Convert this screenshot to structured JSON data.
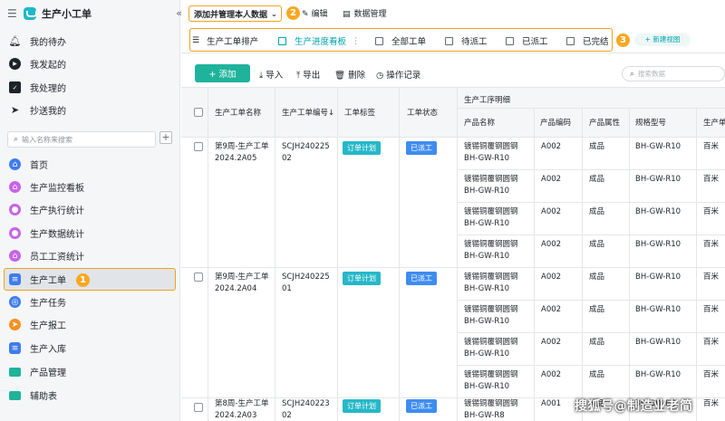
{
  "app": {
    "title": "生产小工单",
    "menu_icon": "hamburger-icon",
    "collapse_glyph": "«"
  },
  "sidebar": {
    "top_items": [
      {
        "label": "我的待办",
        "icon": "bell-icon"
      },
      {
        "label": "我发起的",
        "icon": "play-circle-icon"
      },
      {
        "label": "我处理的",
        "icon": "inbox-icon"
      },
      {
        "label": "抄送我的",
        "icon": "send-icon"
      }
    ],
    "search_placeholder": "输入名称来搜索",
    "plus": "+",
    "items": [
      {
        "label": "首页",
        "icon": "home-icon",
        "color": "#3f7cf1"
      },
      {
        "label": "生产监控看板",
        "icon": "house-icon",
        "color": "#c764e8"
      },
      {
        "label": "生产执行统计",
        "icon": "palette-icon",
        "color": "#c764e8"
      },
      {
        "label": "生产数据统计",
        "icon": "palette-icon",
        "color": "#c764e8"
      },
      {
        "label": "员工工资统计",
        "icon": "house-icon",
        "color": "#c764e8"
      },
      {
        "label": "生产工单",
        "icon": "document-icon",
        "color": "#3f7cf1"
      },
      {
        "label": "生产任务",
        "icon": "target-icon",
        "color": "#3f7cf1"
      },
      {
        "label": "生产报工",
        "icon": "arrow-icon",
        "color": "#f7901e"
      },
      {
        "label": "生产入库",
        "icon": "document-icon",
        "color": "#3f7cf1"
      },
      {
        "label": "产品管理",
        "icon": "folder-icon",
        "color": "#1fb39c"
      },
      {
        "label": "辅助表",
        "icon": "folder-icon",
        "color": "#1fb39c"
      }
    ]
  },
  "badges": {
    "one": "1",
    "two": "2",
    "three": "3"
  },
  "topbar": {
    "view_select": "添加并管理本人数据",
    "edit": "编辑",
    "data_mgmt": "数据管理"
  },
  "tabs": [
    {
      "label": "生产工单排产"
    },
    {
      "label": "生产进度看板",
      "more": "⋮"
    },
    {
      "label": "全部工单"
    },
    {
      "label": "待派工"
    },
    {
      "label": "已派工"
    },
    {
      "label": "已完结"
    }
  ],
  "new_view": "+ 新建视图",
  "toolbar": {
    "add": "+ 添加",
    "import": "导入",
    "export": "导出",
    "delete": "删除",
    "log": "操作记录",
    "search_placeholder": "搜索数据"
  },
  "columns": {
    "name": "生产工单名称",
    "code": "生产工单编号↓",
    "tag": "工单标签",
    "status": "工单状态",
    "group": "生产工序明细",
    "product": "产品名称",
    "pcode": "产品编码",
    "attr": "产品属性",
    "spec": "规格型号",
    "unit": "生产单"
  },
  "orders": [
    {
      "name": "第9周-生产工单2024.2A05",
      "code": "SCJH24022502",
      "tag": "订单计划",
      "status": "已派工",
      "rows": [
        {
          "product": "镀锡铜覆钢圆钢BH-GW-R10",
          "pcode": "A002",
          "attr": "成品",
          "spec": "BH-GW-R10",
          "unit": "百米"
        },
        {
          "product": "镀锡铜覆钢圆钢BH-GW-R10",
          "pcode": "A002",
          "attr": "成品",
          "spec": "BH-GW-R10",
          "unit": "百米"
        },
        {
          "product": "镀锡铜覆钢圆钢BH-GW-R10",
          "pcode": "A002",
          "attr": "成品",
          "spec": "BH-GW-R10",
          "unit": "百米"
        },
        {
          "product": "镀锡铜覆钢圆钢BH-GW-R10",
          "pcode": "A002",
          "attr": "成品",
          "spec": "BH-GW-R10",
          "unit": "百米"
        }
      ]
    },
    {
      "name": "第9周-生产工单2024.2A04",
      "code": "SCJH24022501",
      "tag": "订单计划",
      "status": "已派工",
      "rows": [
        {
          "product": "镀锡铜覆钢圆钢BH-GW-R10",
          "pcode": "A002",
          "attr": "成品",
          "spec": "BH-GW-R10",
          "unit": "百米"
        },
        {
          "product": "镀锡铜覆钢圆钢BH-GW-R10",
          "pcode": "A002",
          "attr": "成品",
          "spec": "BH-GW-R10",
          "unit": "百米"
        },
        {
          "product": "镀锡铜覆钢圆钢BH-GW-R10",
          "pcode": "A002",
          "attr": "成品",
          "spec": "BH-GW-R10",
          "unit": "百米"
        },
        {
          "product": "镀锡铜覆钢圆钢BH-GW-R10",
          "pcode": "A002",
          "attr": "成品",
          "spec": "BH-GW-R10",
          "unit": "百米"
        }
      ]
    },
    {
      "name": "第8周-生产工单2024.2A03",
      "code": "SCJH24022302",
      "tag": "订单计划",
      "status": "已派工",
      "rows": [
        {
          "product": "镀锡铜覆钢圆钢BH-GW-R8",
          "pcode": "A001",
          "attr": "成品",
          "spec": "BH-GW-R8",
          "unit": "百米"
        }
      ]
    }
  ],
  "watermark": "搜狐号@制造业老简",
  "colors": {
    "accent": "#1fb39c",
    "tab_active": "#00a3af",
    "highlight": "#f0a020",
    "tag_plan": "#26b8c8",
    "tag_dispatch": "#3f8cf1"
  }
}
